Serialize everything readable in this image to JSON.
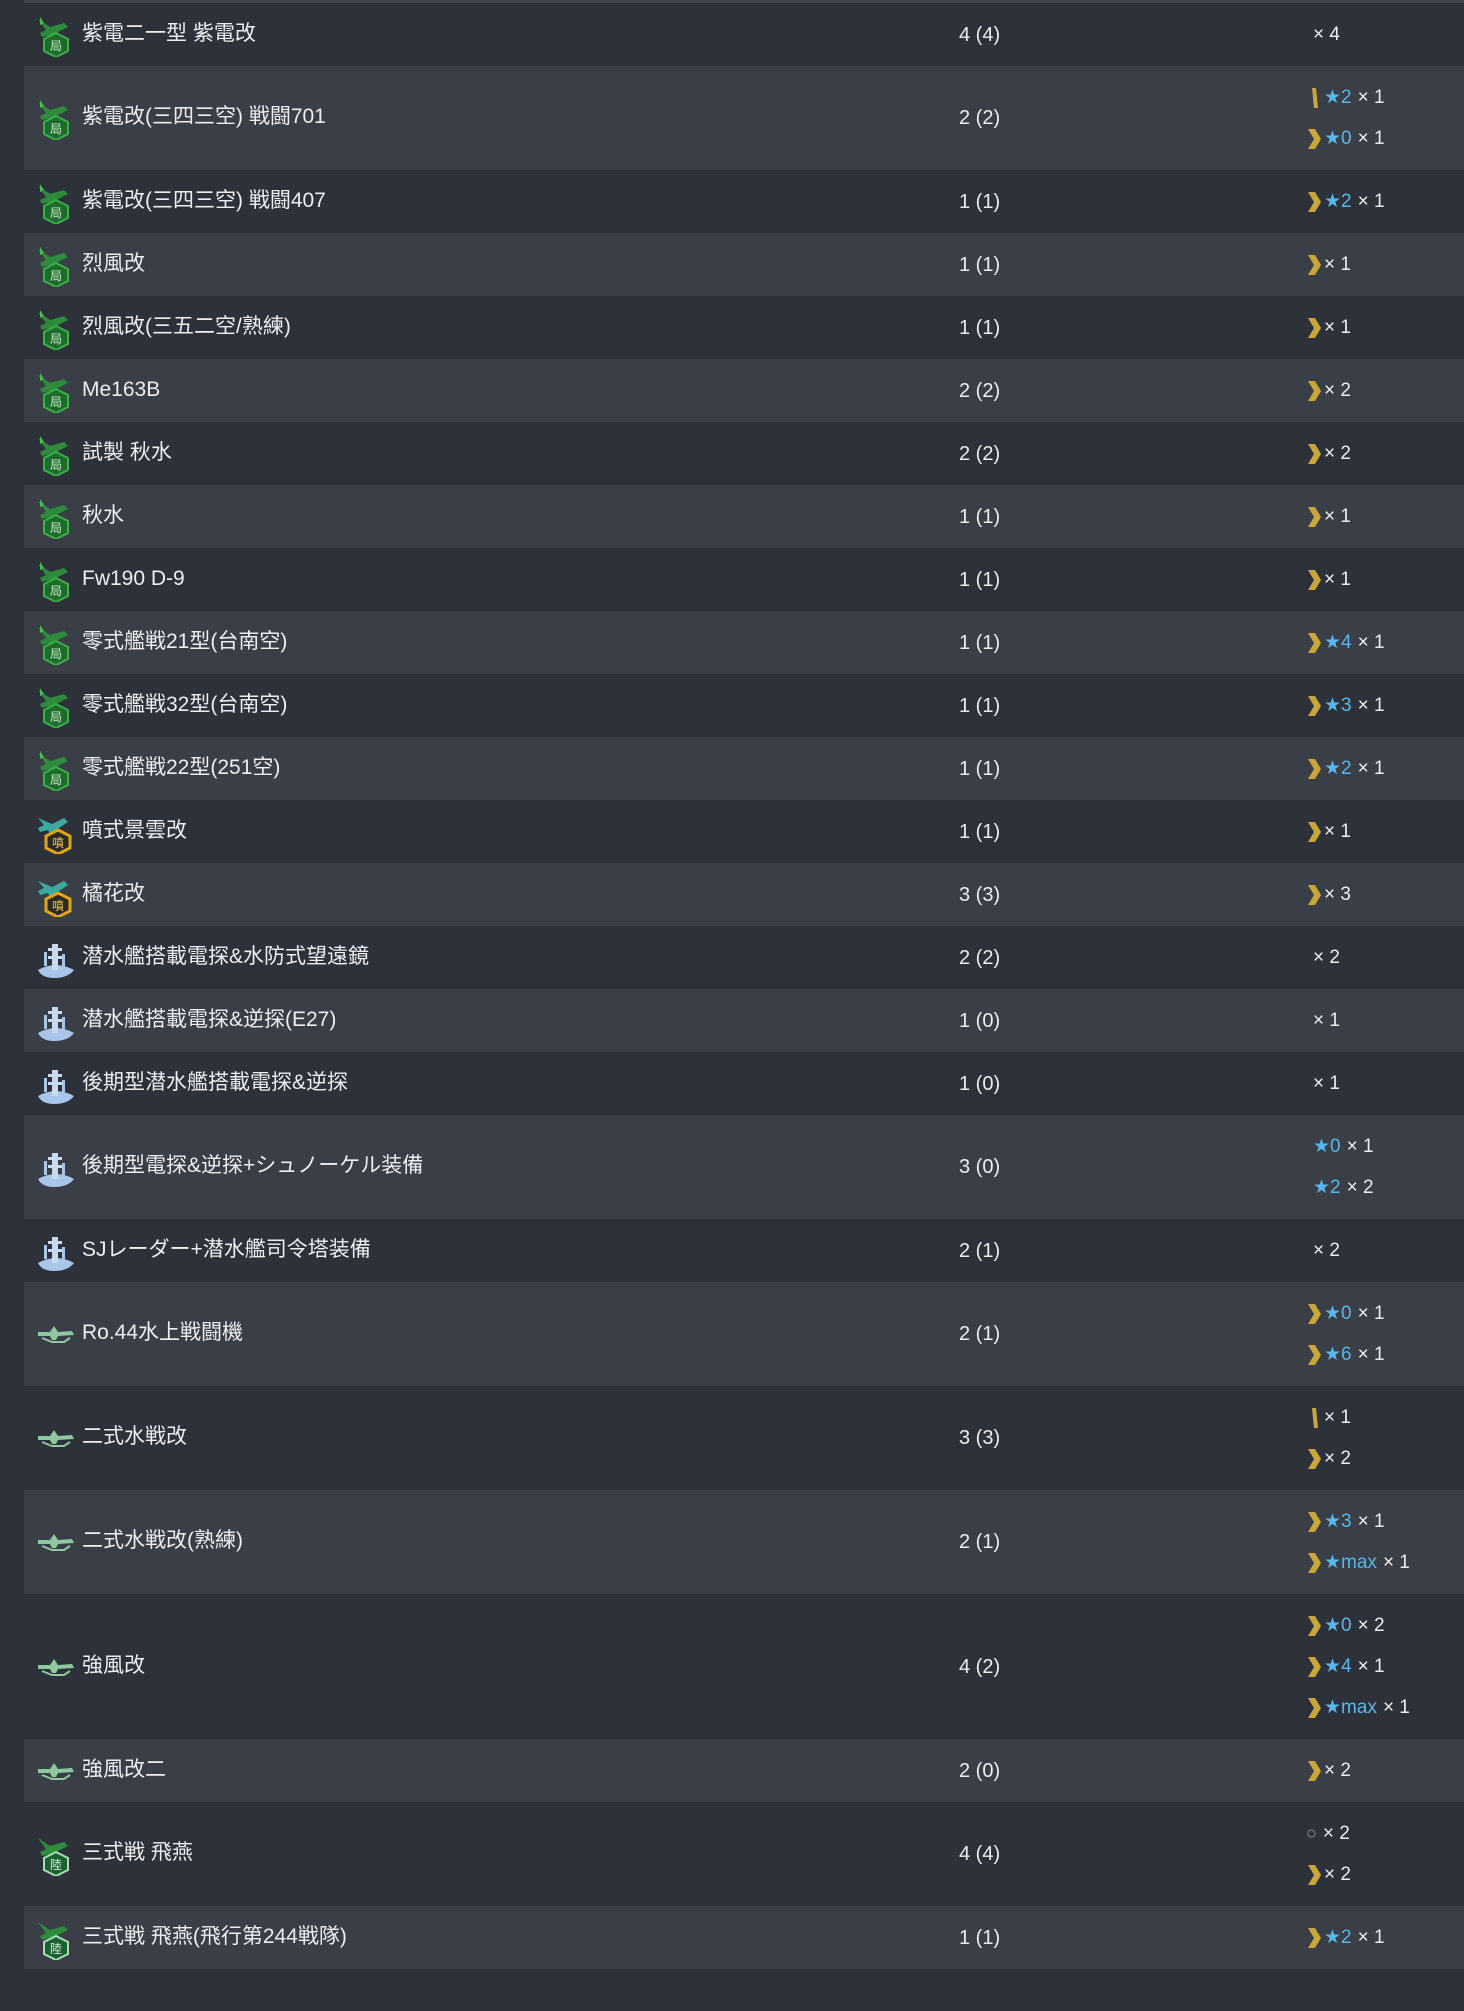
{
  "colors": {
    "row_odd": "#2d3139",
    "row_even": "#3a3e46",
    "text": "#eceef1",
    "star": "#57b7ee",
    "proficiency_chevron": "#c9a63a",
    "proficiency_bar": "#c9a63a",
    "interceptor_icon": "#3ba34a",
    "jet_icon_badge": "#e1a317",
    "radar_icon": "#a9c6ea",
    "seaplane_icon": "#8fc79e"
  },
  "rows": [
    {
      "name": "紫電二一型 紫電改",
      "count": "4 (4)",
      "icon": "interceptor-icon",
      "details": [
        {
          "prof": "",
          "star": "",
          "mult": "× 4"
        }
      ]
    },
    {
      "name": "紫電改(三四三空) 戦闘701",
      "count": "2 (2)",
      "icon": "interceptor-icon",
      "details": [
        {
          "prof": "bar",
          "star": "★2",
          "mult": "× 1"
        },
        {
          "prof": "chevron",
          "star": "★0",
          "mult": "× 1"
        }
      ]
    },
    {
      "name": "紫電改(三四三空) 戦闘407",
      "count": "1 (1)",
      "icon": "interceptor-icon",
      "details": [
        {
          "prof": "chevron",
          "star": "★2",
          "mult": "× 1"
        }
      ]
    },
    {
      "name": "烈風改",
      "count": "1 (1)",
      "icon": "interceptor-icon",
      "details": [
        {
          "prof": "chevron",
          "star": "",
          "mult": "× 1"
        }
      ]
    },
    {
      "name": "烈風改(三五二空/熟練)",
      "count": "1 (1)",
      "icon": "interceptor-icon",
      "details": [
        {
          "prof": "chevron",
          "star": "",
          "mult": "× 1"
        }
      ]
    },
    {
      "name": "Me163B",
      "count": "2 (2)",
      "icon": "interceptor-icon",
      "details": [
        {
          "prof": "chevron",
          "star": "",
          "mult": "× 2"
        }
      ]
    },
    {
      "name": "試製 秋水",
      "count": "2 (2)",
      "icon": "interceptor-icon",
      "details": [
        {
          "prof": "chevron",
          "star": "",
          "mult": "× 2"
        }
      ]
    },
    {
      "name": "秋水",
      "count": "1 (1)",
      "icon": "interceptor-icon",
      "details": [
        {
          "prof": "chevron",
          "star": "",
          "mult": "× 1"
        }
      ]
    },
    {
      "name": "Fw190 D-9",
      "count": "1 (1)",
      "icon": "interceptor-icon",
      "details": [
        {
          "prof": "chevron",
          "star": "",
          "mult": "× 1"
        }
      ]
    },
    {
      "name": "零式艦戦21型(台南空)",
      "count": "1 (1)",
      "icon": "interceptor-icon",
      "details": [
        {
          "prof": "chevron",
          "star": "★4",
          "mult": "× 1"
        }
      ]
    },
    {
      "name": "零式艦戦32型(台南空)",
      "count": "1 (1)",
      "icon": "interceptor-icon",
      "details": [
        {
          "prof": "chevron",
          "star": "★3",
          "mult": "× 1"
        }
      ]
    },
    {
      "name": "零式艦戦22型(251空)",
      "count": "1 (1)",
      "icon": "interceptor-icon",
      "details": [
        {
          "prof": "chevron",
          "star": "★2",
          "mult": "× 1"
        }
      ]
    },
    {
      "name": "噴式景雲改",
      "count": "1 (1)",
      "icon": "jet-icon",
      "details": [
        {
          "prof": "chevron",
          "star": "",
          "mult": "× 1"
        }
      ]
    },
    {
      "name": "橘花改",
      "count": "3 (3)",
      "icon": "jet-icon",
      "details": [
        {
          "prof": "chevron",
          "star": "",
          "mult": "× 3"
        }
      ]
    },
    {
      "name": "潜水艦搭載電探&水防式望遠鏡",
      "count": "2 (2)",
      "icon": "submarine-radar-icon",
      "details": [
        {
          "prof": "",
          "star": "",
          "mult": "× 2"
        }
      ]
    },
    {
      "name": "潜水艦搭載電探&逆探(E27)",
      "count": "1 (0)",
      "icon": "submarine-radar-icon",
      "details": [
        {
          "prof": "",
          "star": "",
          "mult": "× 1"
        }
      ]
    },
    {
      "name": "後期型潜水艦搭載電探&逆探",
      "count": "1 (0)",
      "icon": "submarine-radar-icon",
      "details": [
        {
          "prof": "",
          "star": "",
          "mult": "× 1"
        }
      ]
    },
    {
      "name": "後期型電探&逆探+シュノーケル装備",
      "count": "3 (0)",
      "icon": "submarine-radar-icon",
      "details": [
        {
          "prof": "",
          "star": "★0",
          "mult": "× 1"
        },
        {
          "prof": "",
          "star": "★2",
          "mult": "× 2"
        }
      ]
    },
    {
      "name": "SJレーダー+潜水艦司令塔装備",
      "count": "2 (1)",
      "icon": "submarine-radar-icon",
      "details": [
        {
          "prof": "",
          "star": "",
          "mult": "× 2"
        }
      ]
    },
    {
      "name": "Ro.44水上戦闘機",
      "count": "2 (1)",
      "icon": "seaplane-fighter-icon",
      "details": [
        {
          "prof": "chevron",
          "star": "★0",
          "mult": "× 1"
        },
        {
          "prof": "chevron",
          "star": "★6",
          "mult": "× 1"
        }
      ]
    },
    {
      "name": "二式水戦改",
      "count": "3 (3)",
      "icon": "seaplane-fighter-icon",
      "details": [
        {
          "prof": "bar",
          "star": "",
          "mult": "× 1"
        },
        {
          "prof": "chevron",
          "star": "",
          "mult": "× 2"
        }
      ]
    },
    {
      "name": "二式水戦改(熟練)",
      "count": "2 (1)",
      "icon": "seaplane-fighter-icon",
      "details": [
        {
          "prof": "chevron",
          "star": "★3",
          "mult": "× 1"
        },
        {
          "prof": "chevron",
          "star": "★max",
          "mult": "× 1"
        }
      ]
    },
    {
      "name": "強風改",
      "count": "4 (2)",
      "icon": "seaplane-fighter-icon",
      "details": [
        {
          "prof": "chevron",
          "star": "★0",
          "mult": "× 2"
        },
        {
          "prof": "chevron",
          "star": "★4",
          "mult": "× 1"
        },
        {
          "prof": "chevron",
          "star": "★max",
          "mult": "× 1"
        }
      ]
    },
    {
      "name": "強風改二",
      "count": "2 (0)",
      "icon": "seaplane-fighter-icon",
      "details": [
        {
          "prof": "chevron",
          "star": "",
          "mult": "× 2"
        }
      ]
    },
    {
      "name": "三式戦 飛燕",
      "count": "4 (4)",
      "icon": "army-fighter-icon",
      "details": [
        {
          "prof": "circle",
          "star": "",
          "mult": "× 2",
          "circle": "○"
        },
        {
          "prof": "chevron",
          "star": "",
          "mult": "× 2"
        }
      ]
    },
    {
      "name": "三式戦 飛燕(飛行第244戦隊)",
      "count": "1 (1)",
      "icon": "army-fighter-icon",
      "details": [
        {
          "prof": "chevron",
          "star": "★2",
          "mult": "× 1"
        }
      ]
    }
  ]
}
